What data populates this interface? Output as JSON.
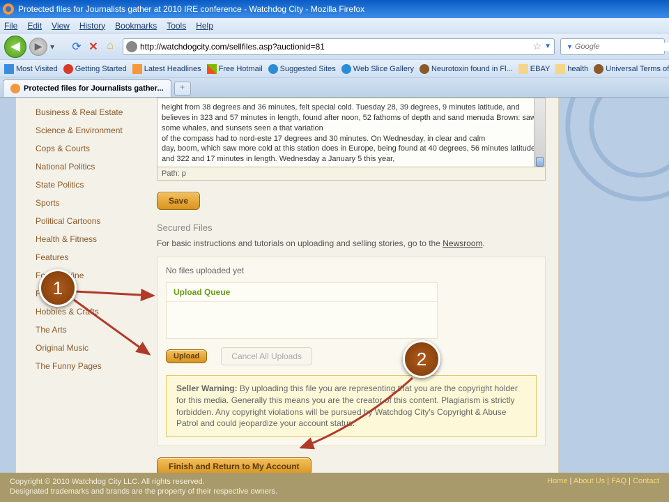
{
  "window": {
    "title": "Protected files for Journalists gather at 2010 IRE conference - Watchdog City - Mozilla Firefox"
  },
  "menubar": [
    "File",
    "Edit",
    "View",
    "History",
    "Bookmarks",
    "Tools",
    "Help"
  ],
  "url": "http://watchdogcity.com/sellfiles.asp?auctionid=81",
  "search_placeholder": "Google",
  "bookmarks": [
    {
      "label": "Most Visited",
      "icon": "bi-blue"
    },
    {
      "label": "Getting Started",
      "icon": "bi-red"
    },
    {
      "label": "Latest Headlines",
      "icon": "bi-orange"
    },
    {
      "label": "Free Hotmail",
      "icon": "bi-ms"
    },
    {
      "label": "Suggested Sites",
      "icon": "bi-ie"
    },
    {
      "label": "Web Slice Gallery",
      "icon": "bi-ie"
    },
    {
      "label": "Neurotoxin found in Fl...",
      "icon": "bi-brown"
    },
    {
      "label": "EBAY",
      "icon": "bi-folder"
    },
    {
      "label": "health",
      "icon": "bi-folder"
    },
    {
      "label": "Universal Terms of",
      "icon": "bi-brown"
    }
  ],
  "tab_title": "Protected files for Journalists gather...",
  "sidebar": {
    "items": [
      "Business & Real Estate",
      "Science & Environment",
      "Cops & Courts",
      "National Politics",
      "State Politics",
      "Sports",
      "Political Cartoons",
      "Health & Fitness",
      "Features",
      "Food & Wine",
      "Fashion",
      "Hobbies & Crafts",
      "The Arts",
      "Original Music",
      "The Funny Pages"
    ]
  },
  "editor": {
    "text": "height from 38 degrees and 36 minutes, felt special cold. Tuesday 28, 39 degrees, 9 minutes latitude, and believes in 323 and 57 minutes in length, found after noon, 52 fathoms of depth and sand menuda Brown: saw some whales, and sunsets seen a that variation\nof the compass had to nord-este 17 degrees and 30 minutes. On Wednesday, in clear and calm\nday, boom, which saw more cold at this station does in Europe, being found at 40 degrees, 56 minutes latitude, and 322 and 17 minutes in length. Wednesday a January 5 this year,",
    "path": "Path: p"
  },
  "buttons": {
    "save": "Save",
    "upload": "Upload",
    "cancel_uploads": "Cancel All Uploads",
    "finish": "Finish and Return to My Account"
  },
  "secured": {
    "heading": "Secured Files",
    "instr_pre": "For basic instructions and tutorials on uploading and selling stories, go to the ",
    "instr_link": "Newsroom",
    "no_files": "No files uploaded yet",
    "upload_queue": "Upload Queue"
  },
  "warning": {
    "label": "Seller Warning:",
    "text": " By uploading this file you are representing that you are the copyright holder for this media. Generally this means you are the creator of this content. Plagiarism is strictly forbidden. Any copyright violations will be pursued by Watchdog City's Copyright & Abuse Patrol and could jeopardize your account status."
  },
  "footer": {
    "copyright": "Copyright © 2010 Watchdog City LLC. All rights reserved.",
    "trademark": "Designated trademarks and brands are the property of their respective owners.",
    "links": [
      "Home",
      "About Us",
      "FAQ",
      "Contact"
    ]
  },
  "callouts": {
    "one": "1",
    "two": "2"
  }
}
